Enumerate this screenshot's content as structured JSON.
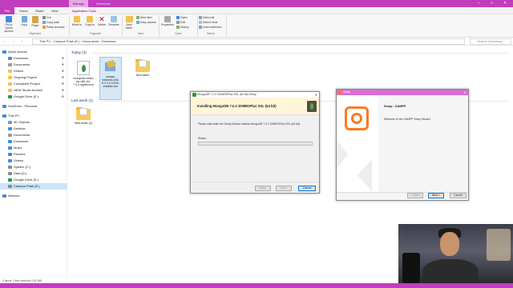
{
  "window": {
    "context_tab": "Manage",
    "folder_name": "Download",
    "controls": [
      "–",
      "□",
      "✕"
    ]
  },
  "ribbon": {
    "tabs": [
      "File",
      "Home",
      "Share",
      "View",
      "Application Tools"
    ],
    "clipboard": {
      "pin": "Pin to Quick access",
      "copy": "Copy",
      "paste": "Paste",
      "cut": "Cut",
      "copy_path": "Copy path",
      "paste_shortcut": "Paste shortcut",
      "label": "Clipboard"
    },
    "organize": {
      "move_to": "Move to",
      "copy_to": "Copy to",
      "delete": "Delete",
      "rename": "Rename",
      "label": "Organize"
    },
    "new": {
      "new_item": "New item",
      "easy_access": "Easy access",
      "new_folder": "New folder",
      "label": "New"
    },
    "open": {
      "properties": "Properties",
      "open": "Open",
      "edit": "Edit",
      "history": "History",
      "label": "Open"
    },
    "select": {
      "select_all": "Select all",
      "select_none": "Select none",
      "invert": "Invert selection",
      "label": "Select"
    }
  },
  "address": {
    "nav": [
      "←",
      "→",
      "↑"
    ],
    "path": "This PC  ›  Campus Pdak (E:)  ›  Documents  ›  Download",
    "search_placeholder": "Search Download"
  },
  "sidebar": {
    "items": [
      {
        "label": "Quick access",
        "color": "#3b8ee0",
        "pin": ""
      },
      {
        "label": "Download",
        "color": "#3b8ee0",
        "pin": "✱"
      },
      {
        "label": "Documents",
        "color": "#9a9a9a",
        "pin": "✱"
      },
      {
        "label": "Videos",
        "color": "#f1c24b",
        "pin": "✱"
      },
      {
        "label": "Ongoing Project",
        "color": "#f1c24b",
        "pin": "✱"
      },
      {
        "label": "Completed Project",
        "color": "#f1c24b",
        "pin": "✱"
      },
      {
        "label": "NEW Studio Archive",
        "color": "#f1c24b",
        "pin": "✱"
      },
      {
        "label": "Google Drive (E:)",
        "color": "#1a9e4a",
        "pin": "✱"
      },
      {
        "label": "OneDrive - Personal",
        "color": "#3b8ee0",
        "pin": ""
      },
      {
        "label": "This PC",
        "color": "#3b8ee0",
        "pin": ""
      },
      {
        "label": "3D Objects",
        "color": "#5aa0e6",
        "pin": ""
      },
      {
        "label": "Desktop",
        "color": "#3b8ee0",
        "pin": ""
      },
      {
        "label": "Documents",
        "color": "#9a9a9a",
        "pin": ""
      },
      {
        "label": "Download",
        "color": "#3b8ee0",
        "pin": ""
      },
      {
        "label": "Music",
        "color": "#3b8ee0",
        "pin": ""
      },
      {
        "label": "Pictures",
        "color": "#3b8ee0",
        "pin": ""
      },
      {
        "label": "Videos",
        "color": "#3b8ee0",
        "pin": ""
      },
      {
        "label": "System (C:)",
        "color": "#8a8a8a",
        "pin": ""
      },
      {
        "label": "Data (D:)",
        "color": "#8a8a8a",
        "pin": ""
      },
      {
        "label": "Google Drive (E:)",
        "color": "#1a9e4a",
        "pin": ""
      },
      {
        "label": "Campus Pdak (E:)",
        "color": "#8a8a8a",
        "pin": ""
      },
      {
        "label": "Network",
        "color": "#3b8ee0",
        "pin": ""
      }
    ]
  },
  "content": {
    "today_header": "Today (3)",
    "lastweek_header": "Last week (1)",
    "today_items": [
      {
        "label": "mongodb-windo ws-x86_64-7.0.2-signed.msi"
      },
      {
        "label": "xampp-windows-x64-8.2.4-0-VS16-installer.exe"
      },
      {
        "label": "New folder"
      }
    ],
    "lastweek_items": [
      {
        "label": "New folder (2)"
      }
    ]
  },
  "mongo_dialog": {
    "title": "MongoDB 7.0.2 2008R2Plus SSL (64 bit) Setup",
    "heading": "Installing MongoDB 7.0.2 2008R2Plus SSL (64 bit)",
    "message": "Please wait while the Setup Wizard installs MongoDB 7.0.2 2008R2Plus SSL (64 bit).",
    "status_label": "Status:",
    "progress": 0.0,
    "back": "Back",
    "next": "Next",
    "cancel": "Cancel"
  },
  "xampp_dialog": {
    "title": "Setup",
    "heading": "Setup - XAMPP",
    "message": "Welcome to the XAMPP Setup Wizard.",
    "back": "< Back",
    "next": "Next >",
    "cancel": "Cancel"
  },
  "status_bar": "4 items   1 item selected   152 MB",
  "colors": {
    "accent": "#c23cbf",
    "xampp_orange": "#fb7a24"
  }
}
